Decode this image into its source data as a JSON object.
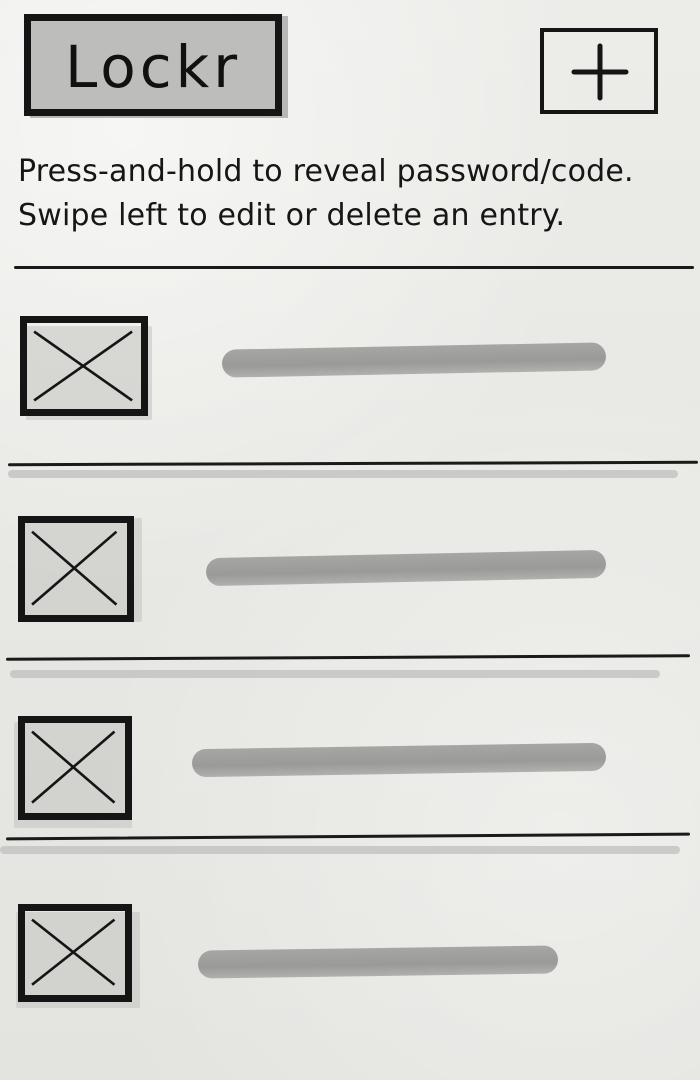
{
  "header": {
    "app_title": "Lockr",
    "add_label": "+"
  },
  "instructions": {
    "line1": "Press-and-hold to reveal password/code.",
    "line2": "Swipe left to edit or delete an entry."
  },
  "entries": [
    {
      "icon": "image-placeholder-icon"
    },
    {
      "icon": "image-placeholder-icon"
    },
    {
      "icon": "image-placeholder-icon"
    },
    {
      "icon": "image-placeholder-icon"
    }
  ],
  "colors": {
    "ink": "#151515",
    "marker_gray": "#a0a09e",
    "paper": "#e9e9e6"
  }
}
